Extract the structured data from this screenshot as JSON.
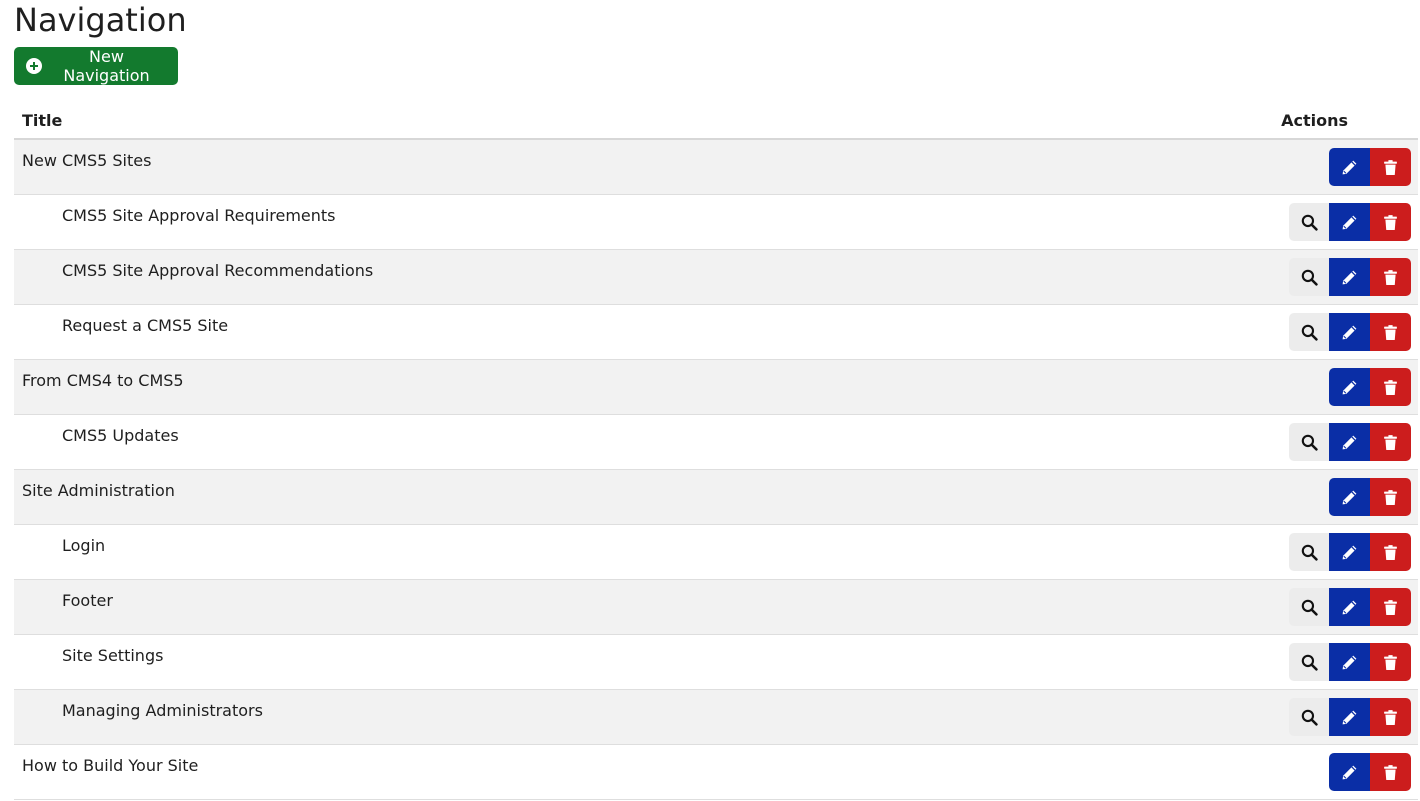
{
  "page": {
    "title": "Navigation",
    "new_button_label": "New Navigation"
  },
  "table": {
    "headers": {
      "title": "Title",
      "actions": "Actions"
    },
    "rows": [
      {
        "title": "New CMS5 Sites",
        "level": 0,
        "has_view": false
      },
      {
        "title": "CMS5 Site Approval Requirements",
        "level": 1,
        "has_view": true
      },
      {
        "title": "CMS5 Site Approval Recommendations",
        "level": 1,
        "has_view": true
      },
      {
        "title": "Request a CMS5 Site",
        "level": 1,
        "has_view": true
      },
      {
        "title": "From CMS4 to CMS5",
        "level": 0,
        "has_view": false
      },
      {
        "title": "CMS5 Updates",
        "level": 1,
        "has_view": true
      },
      {
        "title": "Site Administration",
        "level": 0,
        "has_view": false
      },
      {
        "title": "Login",
        "level": 1,
        "has_view": true
      },
      {
        "title": "Footer",
        "level": 1,
        "has_view": true
      },
      {
        "title": "Site Settings",
        "level": 1,
        "has_view": true
      },
      {
        "title": "Managing Administrators",
        "level": 1,
        "has_view": true
      },
      {
        "title": "How to Build Your Site",
        "level": 0,
        "has_view": false
      }
    ]
  },
  "icons": {
    "new": "plus-circle-icon",
    "view": "search-icon",
    "edit": "pencil-icon",
    "delete": "trash-icon"
  },
  "colors": {
    "new_button": "#137a2e",
    "view_button": "#ececec",
    "edit_button": "#0a2ea6",
    "delete_button": "#cc1d1d",
    "row_stripe": "#f2f2f2"
  }
}
